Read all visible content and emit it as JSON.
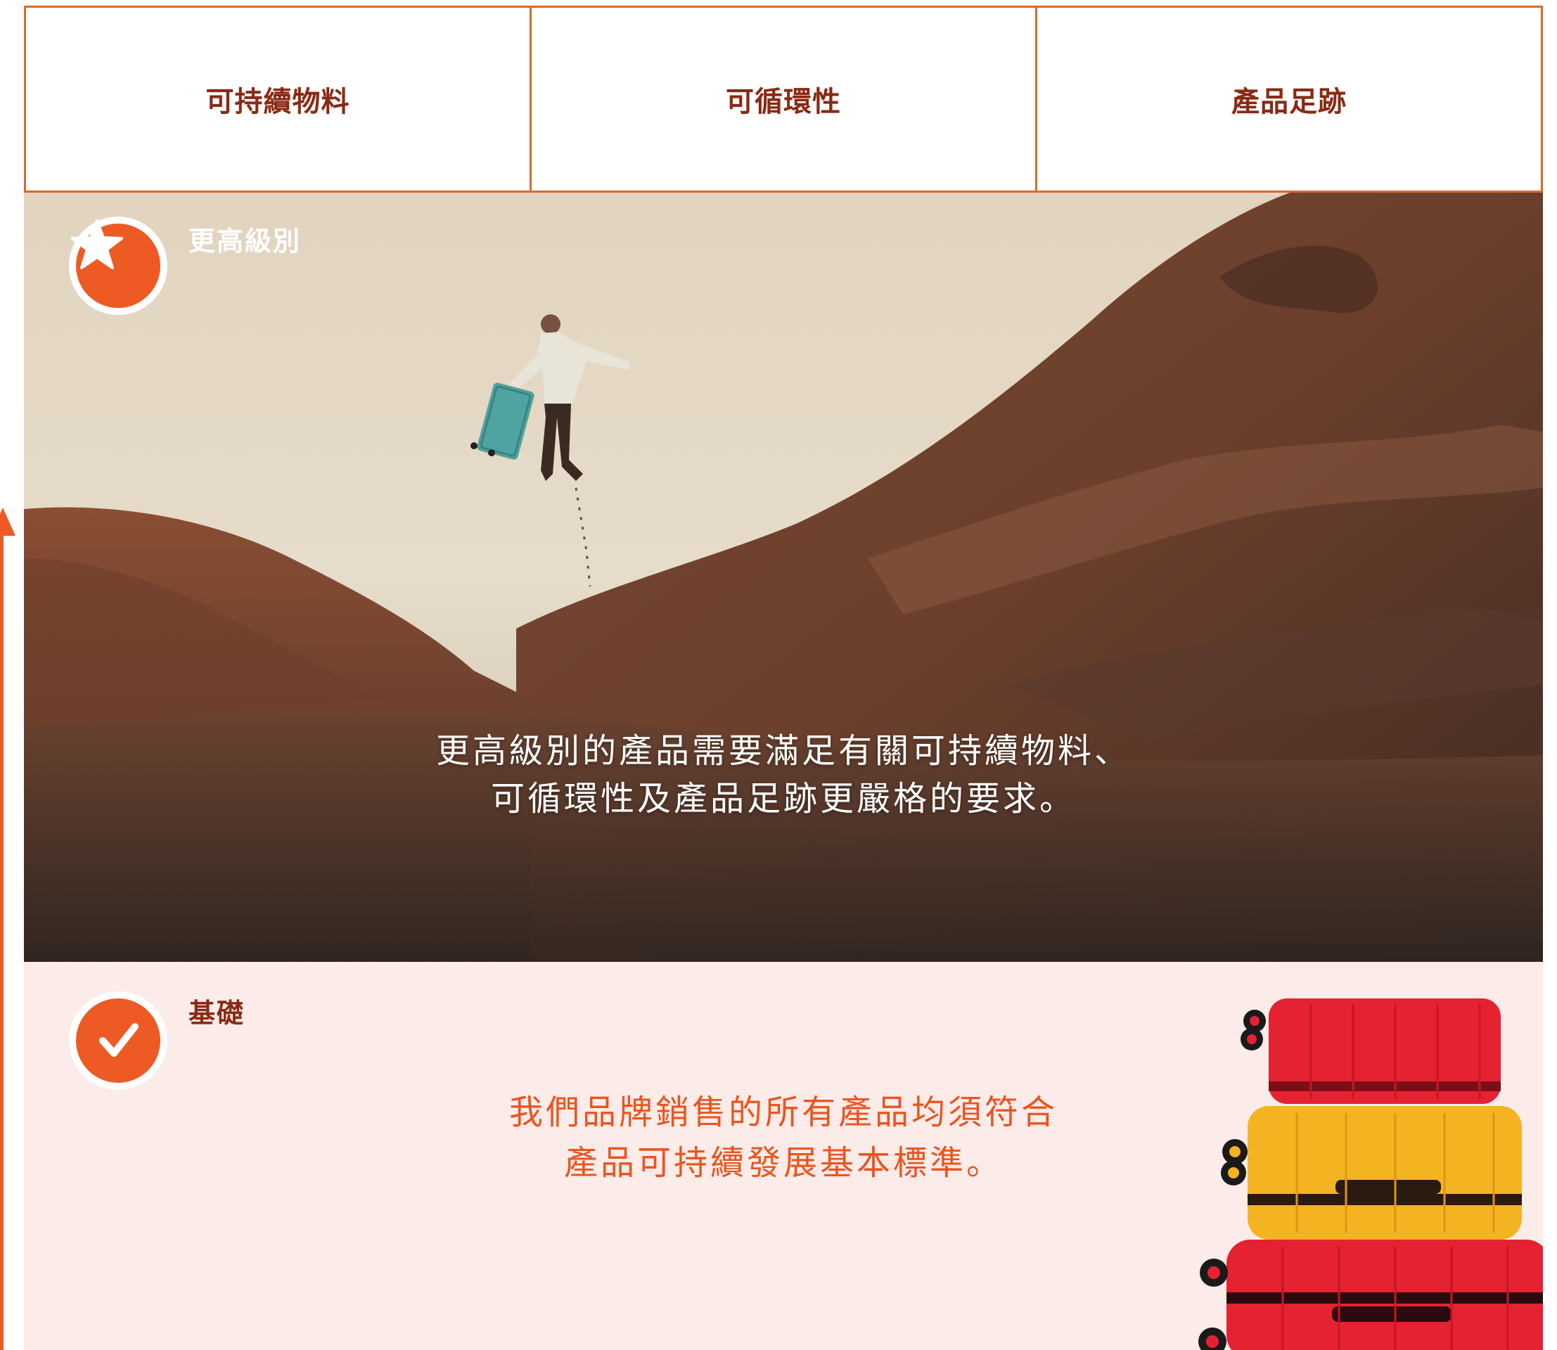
{
  "tabs": [
    {
      "label": "可持續物料"
    },
    {
      "label": "可循環性"
    },
    {
      "label": "產品足跡"
    }
  ],
  "hero": {
    "level_label": "更高級別",
    "icon": "star-icon",
    "description_line1": "更高級別的產品需要滿足有關可持續物料、",
    "description_line2": "可循環性及產品足跡更嚴格的要求。"
  },
  "basic": {
    "level_label": "基礎",
    "icon": "checkmark-icon",
    "description_line1": "我們品牌銷售的所有產品均須符合",
    "description_line2": "產品可持續發展基本標準。"
  },
  "colors": {
    "accent": "#ee5a24",
    "tab_text": "#8a2a14",
    "basic_bg": "#fbece9"
  }
}
